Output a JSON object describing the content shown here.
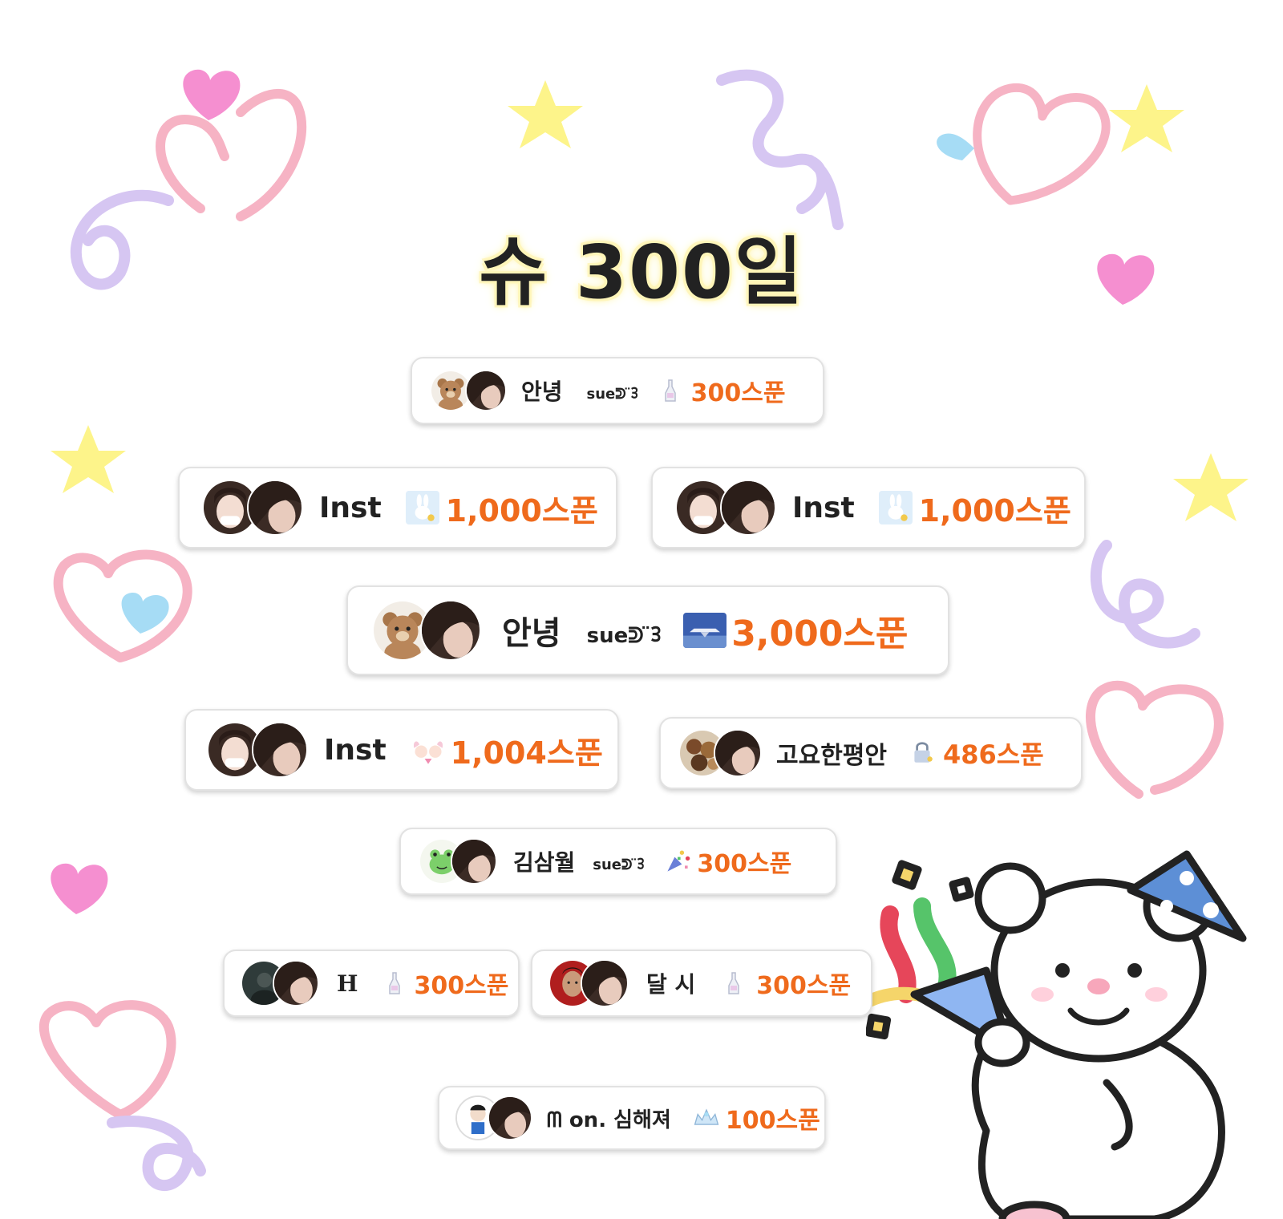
{
  "page": {
    "title": "슈 300일"
  },
  "colors": {
    "amount": "#ef6a1c",
    "card_border": "#e2e2e2",
    "title_glow": "#fff6b8"
  },
  "donations": [
    {
      "name": "안녕",
      "signature": "sueᕲ ̈ᢃ",
      "amount": "300스푼",
      "avatar_icon": "bear-avatar",
      "gift_icon": "bottle-gift-icon"
    },
    {
      "name": "Inst",
      "signature": "",
      "amount": "1,000스푼",
      "avatar_icon": "girl-avatar",
      "gift_icon": "bunny-gift-icon"
    },
    {
      "name": "Inst",
      "signature": "",
      "amount": "1,000스푼",
      "avatar_icon": "girl-avatar",
      "gift_icon": "bunny-gift-icon"
    },
    {
      "name": "안녕",
      "signature": "sueᕲ ̈ᢃ",
      "amount": "3,000스푼",
      "avatar_icon": "bear-avatar",
      "gift_icon": "airplane-gift-icon"
    },
    {
      "name": "Inst",
      "signature": "",
      "amount": "1,004스푼",
      "avatar_icon": "girl-avatar",
      "gift_icon": "angels-gift-icon"
    },
    {
      "name": "고요한평안",
      "signature": "",
      "amount": "486스푼",
      "avatar_icon": "food-avatar",
      "gift_icon": "lock-gift-icon"
    },
    {
      "name": "김삼월",
      "signature": "sueᕲ ̈ᢃ",
      "amount": "300스푼",
      "avatar_icon": "frog-avatar",
      "gift_icon": "confetti-gift-icon"
    },
    {
      "name": "H",
      "signature": "",
      "amount": "300스푼",
      "avatar_icon": "dark-avatar",
      "gift_icon": "bottle-gift-icon"
    },
    {
      "name": "달 시",
      "signature": "",
      "amount": "300스푼",
      "avatar_icon": "man-avatar",
      "gift_icon": "bottle-gift-icon"
    },
    {
      "name": "ᗰ on. 심해져",
      "signature": "",
      "amount": "100스푼",
      "avatar_icon": "cartoon-boy-avatar",
      "gift_icon": "tiara-gift-icon"
    }
  ]
}
